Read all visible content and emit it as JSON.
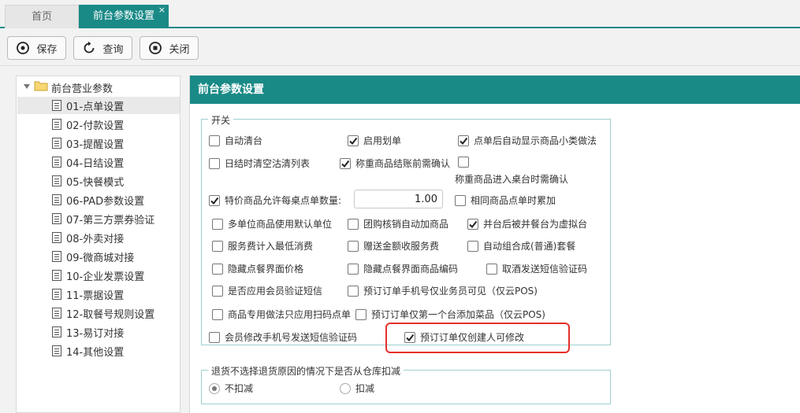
{
  "tabs": [
    {
      "label": "首页",
      "active": false
    },
    {
      "label": "前台参数设置",
      "active": true,
      "close": "×"
    }
  ],
  "toolbar": {
    "save_label": "保存",
    "query_label": "查询",
    "close_label": "关闭"
  },
  "tree": {
    "root": "前台营业参数",
    "items": [
      {
        "label": "01-点单设置",
        "selected": true
      },
      {
        "label": "02-付款设置"
      },
      {
        "label": "03-提醒设置"
      },
      {
        "label": "04-日结设置"
      },
      {
        "label": "05-快餐模式"
      },
      {
        "label": "06-PAD参数设置"
      },
      {
        "label": "07-第三方票券验证"
      },
      {
        "label": "08-外卖对接"
      },
      {
        "label": "09-微商城对接"
      },
      {
        "label": "10-企业发票设置"
      },
      {
        "label": "11-票据设置"
      },
      {
        "label": "12-取餐号规则设置"
      },
      {
        "label": "13-易订对接"
      },
      {
        "label": "14-其他设置"
      }
    ]
  },
  "panel": {
    "title": "前台参数设置",
    "switch_legend": "开关",
    "options": [
      {
        "label": "自动清台",
        "checked": false
      },
      {
        "label": "启用划单",
        "checked": true
      },
      {
        "label": "点单后自动显示商品小类做法",
        "checked": true
      },
      {
        "label": "日结时清空沽清列表",
        "checked": false
      },
      {
        "label": "称重商品结账前需确认",
        "checked": true
      },
      {
        "label": "称重商品进入桌台时需确认",
        "checked": false
      },
      {
        "label": "特价商品允许每桌点单数量:",
        "checked": true
      },
      {
        "label": "相同商品点单时累加",
        "checked": false
      },
      {
        "label": "多单位商品使用默认单位",
        "checked": false
      },
      {
        "label": "团购核销自动加商品",
        "checked": false
      },
      {
        "label": "并台后被并餐台为虚拟台",
        "checked": true
      },
      {
        "label": "服务费计入最低消费",
        "checked": false
      },
      {
        "label": "赠送金额收服务费",
        "checked": false
      },
      {
        "label": "自动组合成(普通)套餐",
        "checked": false
      },
      {
        "label": "隐藏点餐界面价格",
        "checked": false
      },
      {
        "label": "隐藏点餐界面商品编码",
        "checked": false
      },
      {
        "label": "取酒发送短信验证码",
        "checked": false
      },
      {
        "label": "是否应用会员验证短信",
        "checked": false
      },
      {
        "label": "预订订单手机号仅业务员可见（仅云POS)",
        "checked": false
      },
      {
        "label": "商品专用做法只应用扫码点单",
        "checked": false
      },
      {
        "label": "预订订单仅第一个台添加菜品（仅云POS)",
        "checked": false
      },
      {
        "label": "会员修改手机号发送短信验证码",
        "checked": false
      },
      {
        "label": "预订订单仅创建人可修改",
        "checked": true
      }
    ],
    "special_qty_value": "1.00",
    "return_legend": "退货不选择退货原因的情况下是否从仓库扣减",
    "radios": [
      {
        "label": "不扣减",
        "selected": true
      },
      {
        "label": "扣减",
        "selected": false
      }
    ]
  },
  "colors": {
    "accent": "#1a8a87",
    "highlight": "#e5302a"
  }
}
